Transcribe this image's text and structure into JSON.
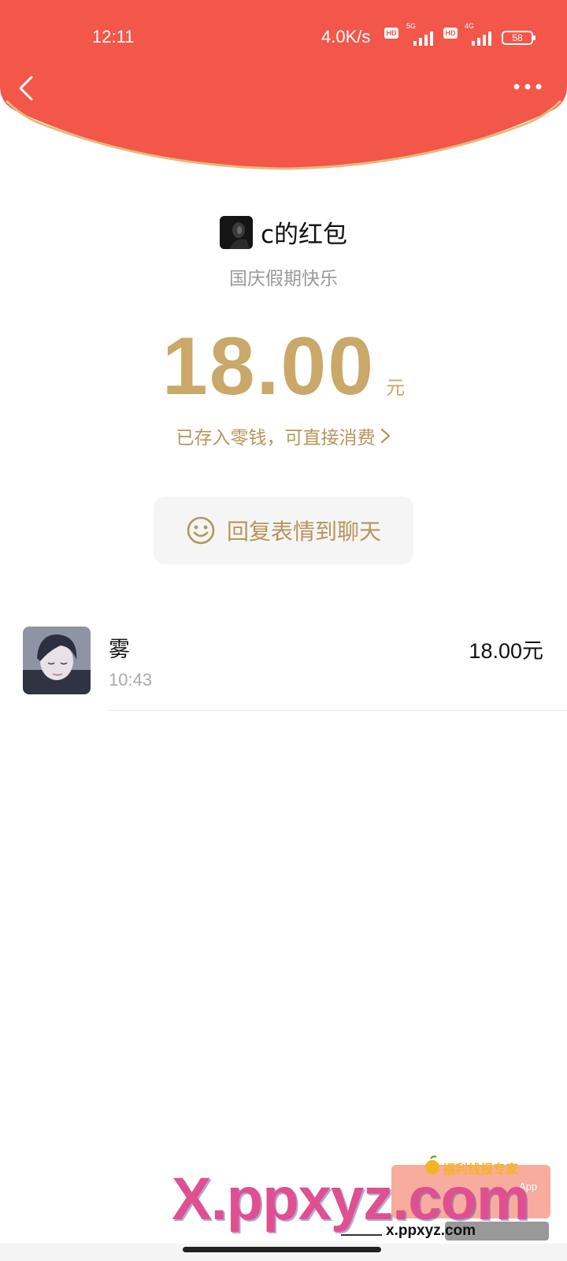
{
  "colors": {
    "header_red": "#f2574a",
    "gold": "#c9a86a",
    "gold_text": "#b6955a"
  },
  "status_bar": {
    "time": "12:11",
    "speed": "4.0K/s",
    "hd1": "HD",
    "net1": "5G",
    "hd2": "HD",
    "net2": "4G",
    "battery": "58"
  },
  "nav": {
    "back_icon": "chevron-left-icon",
    "more_icon": "more-dots-icon"
  },
  "packet": {
    "sender_title": "c的红包",
    "blessing": "国庆假期快乐",
    "amount": "18.00",
    "unit": "元",
    "deposit_note": "已存入零钱，可直接消费"
  },
  "reply_button": {
    "icon": "smiley-icon",
    "label": "回复表情到聊天"
  },
  "receivers": [
    {
      "name": "雾",
      "time": "10:43",
      "amount": "18.00元"
    }
  ],
  "watermark": {
    "main": "X.ppxyz.com",
    "tag": "福利线报专家",
    "app": "App",
    "url": "x.ppxyz.com"
  }
}
